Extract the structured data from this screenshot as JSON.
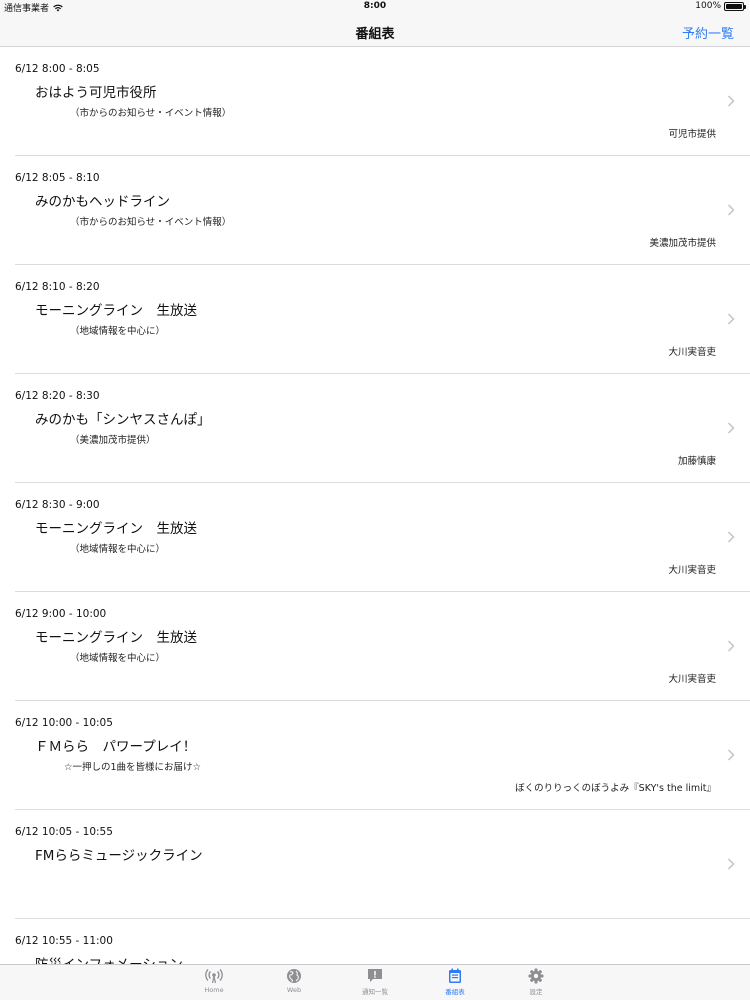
{
  "status_bar": {
    "carrier": "通信事業者",
    "time": "8:00",
    "battery": "100%",
    "battery_level": 1.0
  },
  "nav": {
    "title": "番組表",
    "right_action": "予約一覧"
  },
  "programs": [
    {
      "time": "6/12 8:00 - 8:05",
      "title": "おはよう可児市役所",
      "subtitle": "（市からのお知らせ・イベント情報）",
      "provider": "可児市提供"
    },
    {
      "time": "6/12 8:05 - 8:10",
      "title": "みのかもヘッドライン",
      "subtitle": "（市からのお知らせ・イベント情報）",
      "provider": "美濃加茂市提供"
    },
    {
      "time": "6/12 8:10 - 8:20",
      "title": "モーニングライン　生放送",
      "subtitle": "（地域情報を中心に）",
      "provider": "大川実音吏"
    },
    {
      "time": "6/12 8:20 - 8:30",
      "title": "みのかも「シンヤスさんぽ」",
      "subtitle": "（美濃加茂市提供）",
      "provider": "加藤慎康"
    },
    {
      "time": "6/12 8:30 - 9:00",
      "title": "モーニングライン　生放送",
      "subtitle": "（地域情報を中心に）",
      "provider": "大川実音吏"
    },
    {
      "time": "6/12 9:00 - 10:00",
      "title": "モーニングライン　生放送",
      "subtitle": "（地域情報を中心に）",
      "provider": "大川実音吏"
    },
    {
      "time": "6/12 10:00 - 10:05",
      "title": "ＦＭらら　パワープレイ！",
      "subtitle": "☆一押しの1曲を皆様にお届け☆",
      "provider": "ぼくのりりっくのぼうよみ『SKY's the limit』"
    },
    {
      "time": "6/12 10:05 - 10:55",
      "title": "FMららミュージックライン",
      "subtitle": "",
      "provider": ""
    },
    {
      "time": "6/12 10:55 - 11:00",
      "title": "防災インフォメーション",
      "subtitle": "",
      "provider": ""
    }
  ],
  "tabs": [
    {
      "label": "Home",
      "icon": "radio-antenna-icon",
      "active": false
    },
    {
      "label": "Web",
      "icon": "globe-icon",
      "active": false
    },
    {
      "label": "通知一覧",
      "icon": "notification-icon",
      "active": false
    },
    {
      "label": "番組表",
      "icon": "schedule-icon",
      "active": true
    },
    {
      "label": "設定",
      "icon": "gear-icon",
      "active": false
    }
  ],
  "colors": {
    "accent": "#2d7cf6",
    "inactive_tab": "#8e8e93"
  }
}
